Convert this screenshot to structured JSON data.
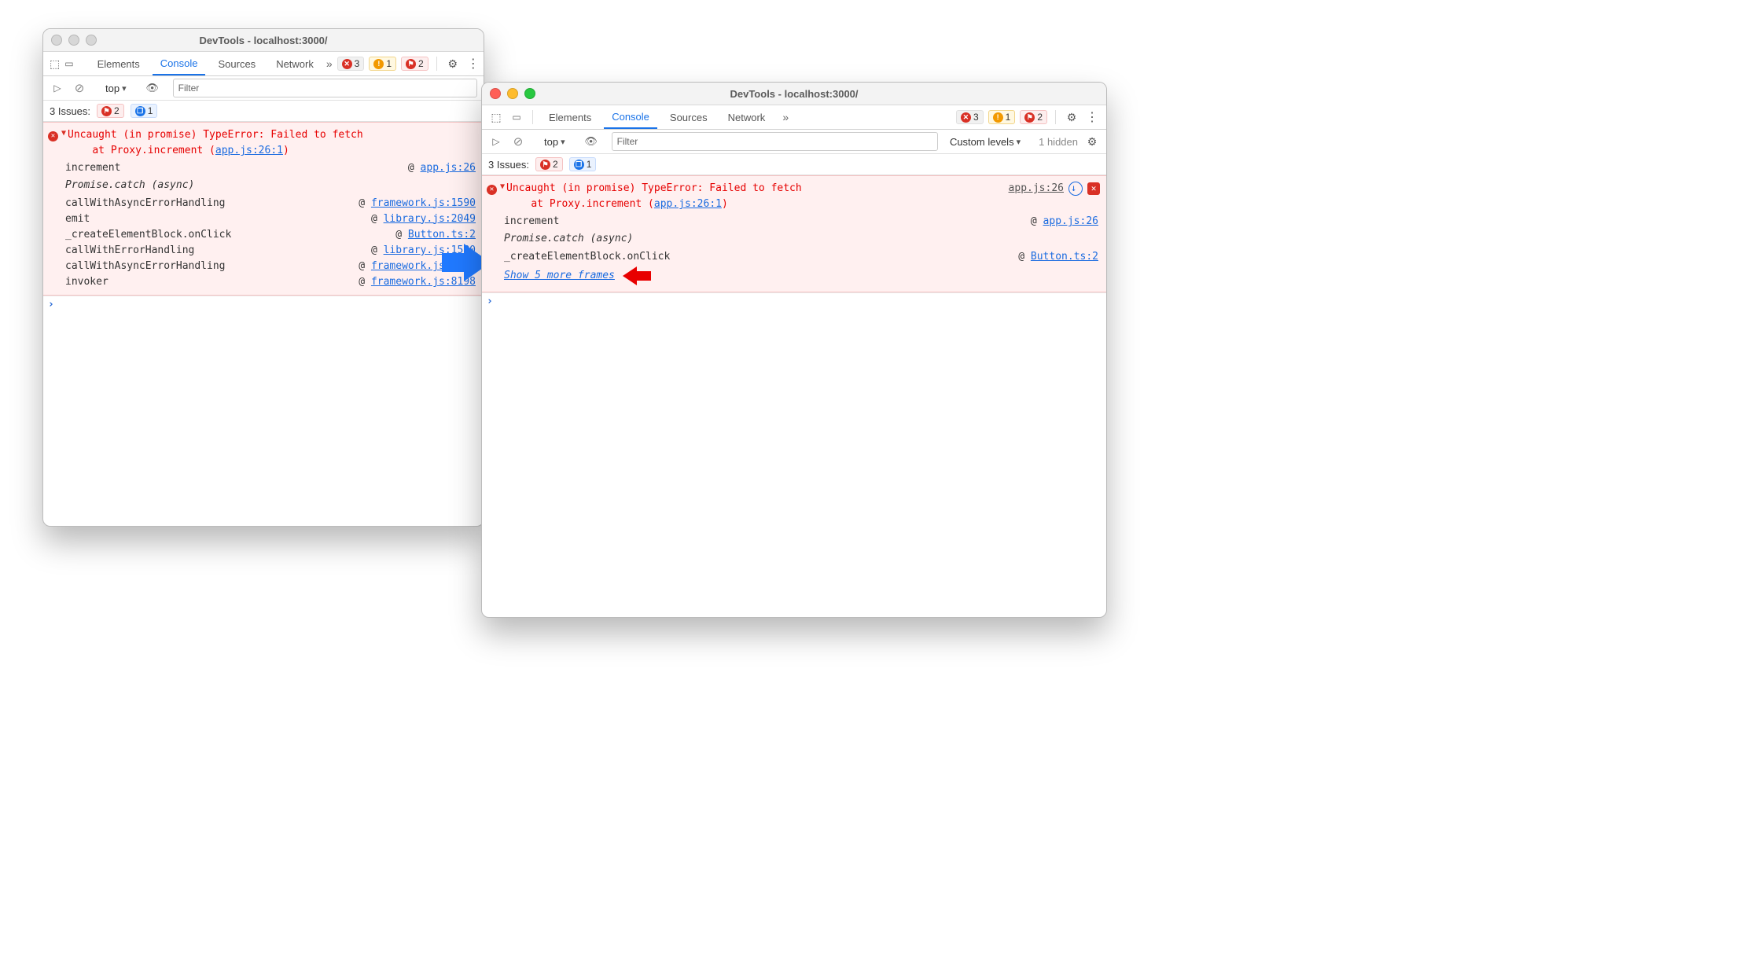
{
  "w1": {
    "title": "DevTools - localhost:3000/",
    "tabs": {
      "elements": "Elements",
      "console": "Console",
      "sources": "Sources",
      "network": "Network"
    },
    "chips": {
      "err": "3",
      "warn": "1",
      "flag": "2"
    },
    "toolbar": {
      "scope": "top",
      "filter_placeholder": "Filter"
    },
    "issues": {
      "label": "3 Issues:",
      "flag": "2",
      "msg": "1"
    },
    "error": {
      "headline": "Uncaught (in promise) TypeError: Failed to fetch",
      "at_prefix": "at Proxy.increment (",
      "at_link": "app.js:26:1",
      "at_suffix": ")",
      "frames": [
        {
          "fn": "increment",
          "link": "app.js:26"
        }
      ],
      "sep": "Promise.catch (async)",
      "frames2": [
        {
          "fn": "callWithAsyncErrorHandling",
          "link": "framework.js:1590"
        },
        {
          "fn": "emit",
          "link": "library.js:2049"
        },
        {
          "fn": "_createElementBlock.onClick",
          "link": "Button.ts:2"
        },
        {
          "fn": "callWithErrorHandling",
          "link": "library.js:1580"
        },
        {
          "fn": "callWithAsyncErrorHandling",
          "link": "framework.js:1588"
        },
        {
          "fn": "invoker",
          "link": "framework.js:8198"
        }
      ]
    }
  },
  "w2": {
    "title": "DevTools - localhost:3000/",
    "tabs": {
      "elements": "Elements",
      "console": "Console",
      "sources": "Sources",
      "network": "Network"
    },
    "chips": {
      "err": "3",
      "warn": "1",
      "flag": "2"
    },
    "toolbar": {
      "scope": "top",
      "filter_placeholder": "Filter",
      "levels": "Custom levels",
      "hidden": "1 hidden"
    },
    "issues": {
      "label": "3 Issues:",
      "flag": "2",
      "msg": "1"
    },
    "error": {
      "headline": "Uncaught (in promise) TypeError: Failed to fetch",
      "at_prefix": "at Proxy.increment (",
      "at_link": "app.js:26:1",
      "at_suffix": ")",
      "srcloc": "app.js:26",
      "frames": [
        {
          "fn": "increment",
          "link": "app.js:26"
        }
      ],
      "sep": "Promise.catch (async)",
      "frames2": [
        {
          "fn": "_createElementBlock.onClick",
          "link": "Button.ts:2"
        }
      ],
      "show_more": "Show 5 more frames"
    }
  }
}
